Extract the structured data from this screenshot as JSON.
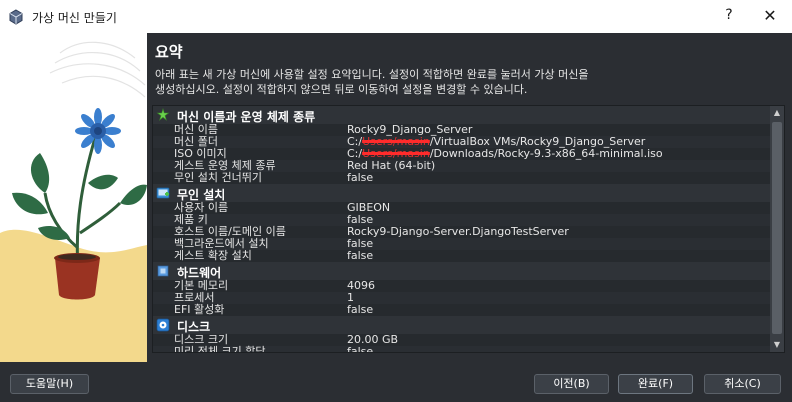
{
  "window": {
    "title": "가상 머신 만들기",
    "help_glyph": "?",
    "close_glyph": "✕"
  },
  "page": {
    "heading": "요약",
    "description_line1": "아래 표는 새 가상 머신에 사용할 설정 요약입니다. 설정이 적합하면 완료를 눌러서 가상 머신을",
    "description_line2": "생성하십시오. 설정이 적합하지 않으면 뒤로 이동하여 설정을 변경할 수 있습니다."
  },
  "summary": {
    "sections": [
      {
        "title": "머신 이름과 운영 체제 종류",
        "icon": "star-icon",
        "rows": [
          {
            "key": "머신 이름",
            "value": "Rocky9_Django_Server"
          },
          {
            "key": "머신 폴더",
            "value_prefix": "C:/",
            "value_redacted": "Users/masin",
            "value_suffix": "/VirtualBox VMs/Rocky9_Django_Server"
          },
          {
            "key": "ISO 이미지",
            "value_prefix": "C:/",
            "value_redacted": "Users/masin",
            "value_suffix": "/Downloads/Rocky-9.3-x86_64-minimal.iso"
          },
          {
            "key": "게스트 운영 체제 종류",
            "value": "Red Hat (64-bit)"
          },
          {
            "key": "무인 설치 건너뛰기",
            "value": "false"
          }
        ]
      },
      {
        "title": "무인 설치",
        "icon": "unattended-install-icon",
        "rows": [
          {
            "key": "사용자 이름",
            "value": "GIBEON"
          },
          {
            "key": "제품 키",
            "value": "false"
          },
          {
            "key": "호스트 이름/도메인 이름",
            "value": "Rocky9-Django-Server.DjangoTestServer"
          },
          {
            "key": "백그라운드에서 설치",
            "value": "false"
          },
          {
            "key": "게스트 확장 설치",
            "value": "false"
          }
        ]
      },
      {
        "title": "하드웨어",
        "icon": "hardware-chip-icon",
        "rows": [
          {
            "key": "기본 메모리",
            "value": "4096"
          },
          {
            "key": "프로세서",
            "value": "1"
          },
          {
            "key": "EFI 활성화",
            "value": "false"
          }
        ]
      },
      {
        "title": "디스크",
        "icon": "disk-icon",
        "rows": [
          {
            "key": "디스크 크기",
            "value": "20.00 GB"
          },
          {
            "key": "미리 전체 크기 할당",
            "value": "false"
          }
        ]
      }
    ]
  },
  "buttons": {
    "help": "도움말(H)",
    "back": "이전(B)",
    "finish": "완료(F)",
    "cancel": "취소(C)"
  },
  "colors": {
    "background": "#2b2e33",
    "title_bar": "#ffffff",
    "redaction": "#ff2b2b"
  }
}
